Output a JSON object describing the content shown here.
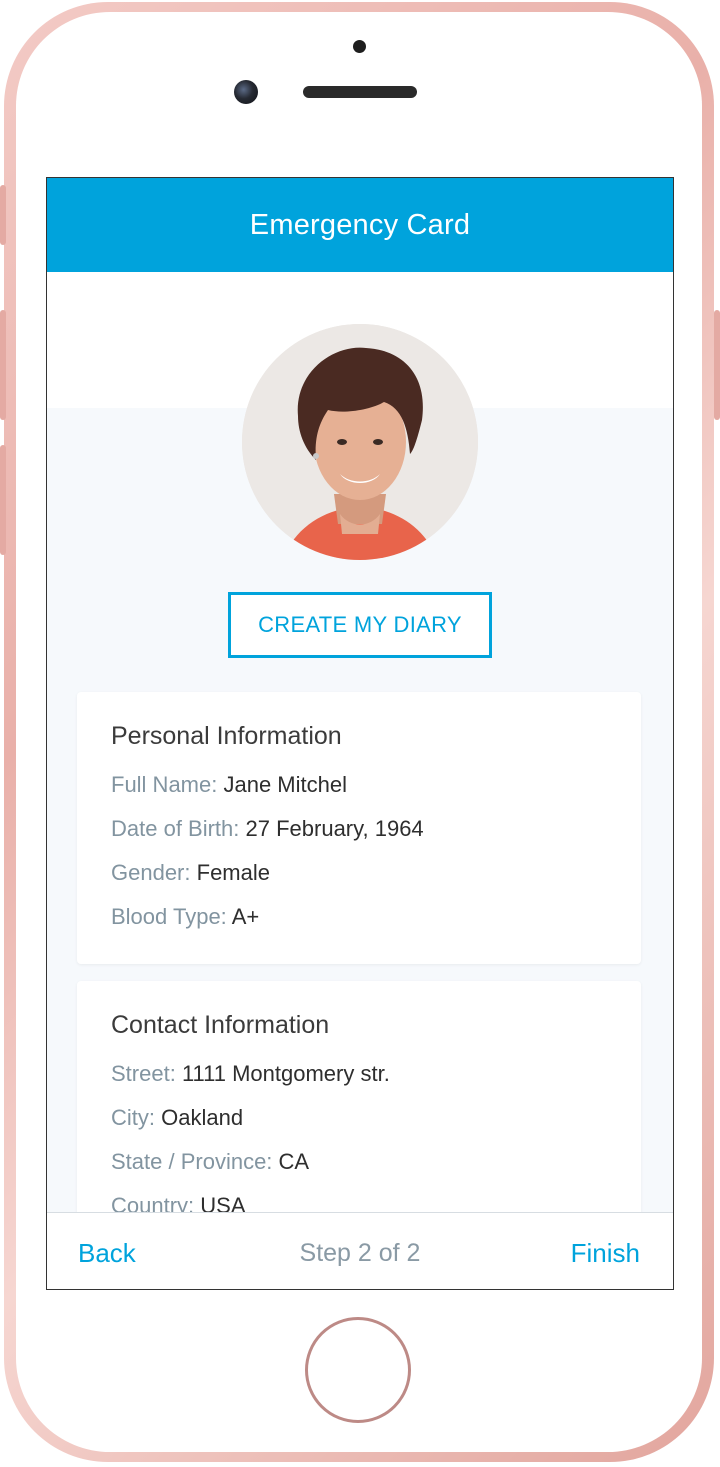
{
  "header": {
    "title": "Emergency Card"
  },
  "profile": {
    "avatar_icon": "user-photo"
  },
  "actions": {
    "create_diary_label": "CREATE MY DIARY"
  },
  "personal": {
    "title": "Personal Information",
    "rows": [
      {
        "label": "Full Name:",
        "value": "Jane Mitchel"
      },
      {
        "label": "Date of Birth:",
        "value": "27 February, 1964"
      },
      {
        "label": "Gender:",
        "value": "Female"
      },
      {
        "label": "Blood Type:",
        "value": "A+"
      }
    ]
  },
  "contact": {
    "title": "Contact Information",
    "rows": [
      {
        "label": "Street:",
        "value": "1111 Montgomery str."
      },
      {
        "label": "City:",
        "value": "Oakland"
      },
      {
        "label": "State / Province:",
        "value": "CA"
      },
      {
        "label": "Country:",
        "value": "USA"
      }
    ]
  },
  "footer": {
    "back_label": "Back",
    "step_text": "Step 2 of 2",
    "finish_label": "Finish"
  },
  "colors": {
    "accent": "#00a3dc",
    "label": "#8294a0",
    "value": "#2e2e2e",
    "page_bg": "#f6f9fc"
  }
}
